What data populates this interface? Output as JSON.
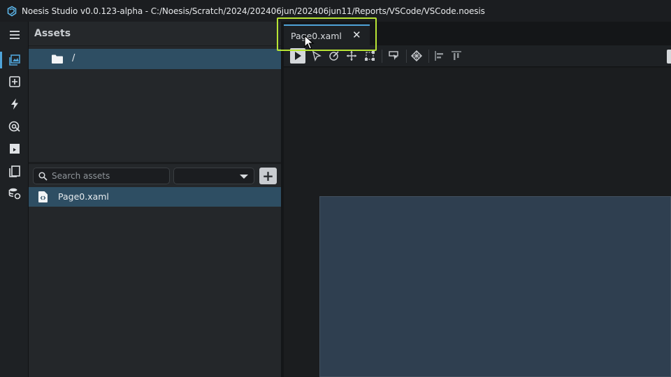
{
  "window": {
    "title": "Noesis Studio v0.0.123-alpha - C:/Noesis/Scratch/2024/202406jun/202406jun11/Reports/VSCode/VSCode.noesis"
  },
  "rail": {
    "items": [
      "menu-icon",
      "assets-icon",
      "add-element-icon",
      "events-icon",
      "data-icon",
      "animation-icon",
      "pages-icon",
      "resources-icon"
    ],
    "active_index": 1
  },
  "assets_panel": {
    "title": "Assets",
    "root_folder": "/",
    "search": {
      "placeholder": "Search assets",
      "value": ""
    },
    "filter": {
      "value": ""
    },
    "add_label": "+",
    "files": [
      {
        "name": "Page0.xaml",
        "icon": "xaml-file-icon",
        "selected": true
      }
    ]
  },
  "editor": {
    "tabs": [
      {
        "label": "Page0.xaml",
        "close_label": "✕",
        "active": true
      }
    ],
    "toolbar": [
      "play-icon",
      "select-icon",
      "pen-icon",
      "move-icon",
      "transform-icon",
      "pick-icon",
      "grid-icon",
      "align-left-icon",
      "align-top-icon"
    ]
  },
  "colors": {
    "accent": "#4fa3d8",
    "selection": "#2e4e63",
    "highlight": "#b8e534",
    "page": "#2f3f50"
  }
}
